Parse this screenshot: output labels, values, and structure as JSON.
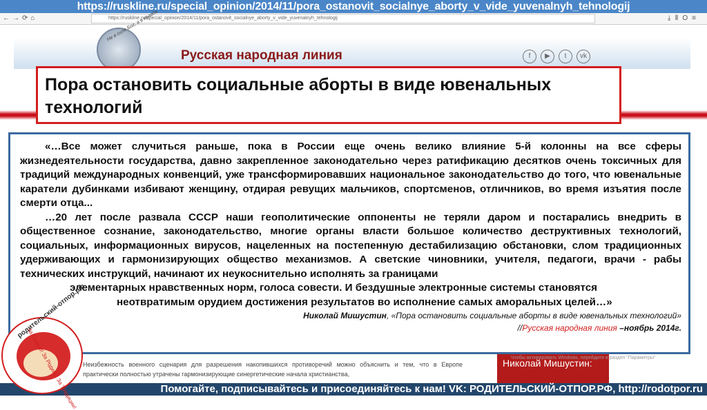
{
  "banner": {
    "url": "https://ruskline.ru/special_opinion/2014/11/pora_ostanovit_socialnye_aborty_v_vide_yuvenalnyh_tehnologij"
  },
  "browser": {
    "address": "https://ruskline.ru/special_opinion/2014/11/pora_ostanovit_socialnye_aborty_v_vide_yuvenalnyh_tehnologij"
  },
  "site": {
    "name": "Русская народная линия",
    "motto": "Не в силе Бог, а в правде",
    "social": [
      "f",
      "yt",
      "t",
      "vk"
    ]
  },
  "article": {
    "title": "Пора остановить социальные аборты в виде ювенальных технологий"
  },
  "quote": {
    "p1": "«…Все может случиться раньше, пока в России еще очень велико влияние 5-й колонны на все сферы жизнедеятельности государства, давно закрепленное законодательно через ратификацию десятков очень токсичных для традиций международных конвенций, уже трансформировавших национальное законодательство до того, что ювенальные каратели дубинками избивают женщину, отдирая ревущих мальчиков, спортсменов, отличников, во время изъятия после смерти отца...",
    "p2": "…20 лет после развала СССР наши геополитические оппоненты не теряли даром и постарались внедрить в общественное сознание, законодательство, многие органы власти большое количество деструктивных технологий, социальных, информационных вирусов, нацеленных на постепенную дестабилизацию обстановки, слом традиционных удерживающих и гармонизирующих общество механизмов. А светские чиновники, учителя, педагоги, врачи - рабы технических инструкций, начинают их неукоснительно исполнять за границами",
    "p3": "элементарных нравственных норм, голоса совести. И бездушные электронные системы становятся",
    "p4": "неотвратимым орудием достижения результатов во исполнение самых аморальных целей…»",
    "author": "Николай Мишустин",
    "work": ", «Пора остановить социальные аборты в виде ювенальных технологий»",
    "src_prefix": "//",
    "source": "Русская народная линия",
    "date": " –ноябрь 2014г."
  },
  "page_below": {
    "text": "Неизбежность военного сценария для разрешения накопившихся противоречий можно объяснить и тем, что в Европе практически полностью утрачены гармонизирующие синергетические начала христианства,",
    "author_box": "Николай Мишустин:",
    "windows_notice": "Чтобы активировать Windows, перейдите в раздел \"Параметры\""
  },
  "org_logo": {
    "name": "родительский-отпор.рф",
    "slogan": "За Семью! За Родину! За Традиции!"
  },
  "footer": {
    "text": "Помогайте, подписывайтесь и присоединяйтесь к нам! VK: РОДИТЕЛЬСКИЙ-ОТПОР.РФ, http://rodotpor.ru"
  }
}
